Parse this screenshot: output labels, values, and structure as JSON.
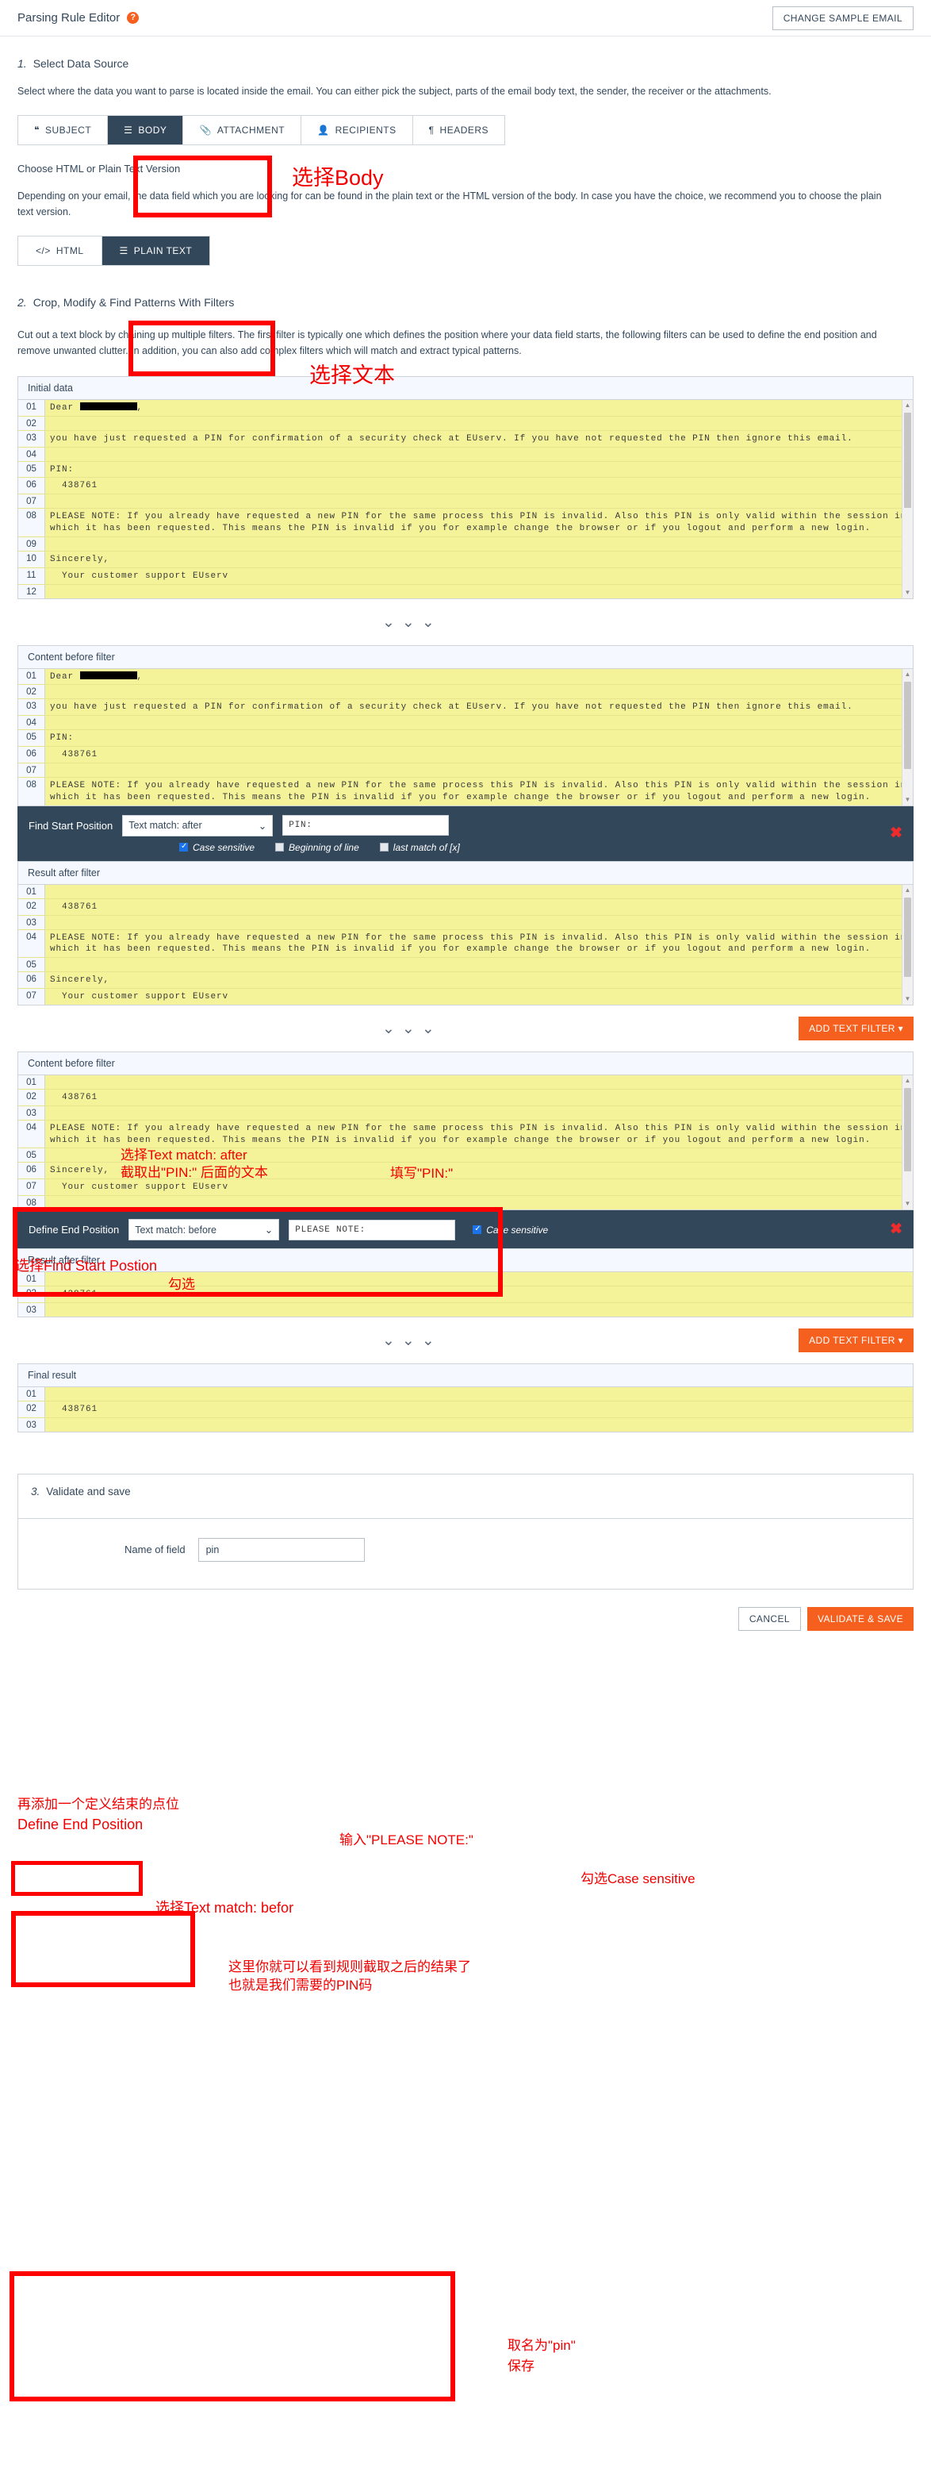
{
  "header": {
    "title": "Parsing Rule Editor",
    "help_icon": "question-mark-circle-icon",
    "change_sample_button": "CHANGE SAMPLE EMAIL"
  },
  "step1": {
    "number": "1.",
    "title": "Select Data Source",
    "description": "Select where the data you want to parse is located inside the email. You can either pick the subject, parts of the email body text, the sender, the receiver or the attachments.",
    "source_tabs": [
      {
        "label": "SUBJECT",
        "icon": "quote-icon",
        "active": false
      },
      {
        "label": "BODY",
        "icon": "lines-icon",
        "active": true
      },
      {
        "label": "ATTACHMENT",
        "icon": "paperclip-icon",
        "active": false
      },
      {
        "label": "RECIPIENTS",
        "icon": "user-icon",
        "active": false
      },
      {
        "label": "HEADERS",
        "icon": "pilcrow-icon",
        "active": false
      }
    ],
    "version_label": "Choose HTML or Plain Text Version",
    "version_description": "Depending on your email, the data field which you are looking for can be found in the plain text or the HTML version of the body. In case you have the choice, we recommend you to choose the plain text version.",
    "version_tabs": [
      {
        "label": "HTML",
        "icon": "code-icon",
        "active": false
      },
      {
        "label": "PLAIN TEXT",
        "icon": "lines-icon",
        "active": true
      }
    ]
  },
  "step2": {
    "number": "2.",
    "title": "Crop, Modify & Find Patterns With Filters",
    "description": "Cut out a text block by chaining up multiple filters. The first filter is typically one which defines the position where your data field starts, the following filters can be used to define the end position and remove unwanted clutter. In addition, you can also add complex filters which will match and extract typical patterns."
  },
  "panels": {
    "initial_data": {
      "title": "Initial data",
      "rows": [
        {
          "n": "01",
          "text": "Dear ████████,",
          "redacted": true
        },
        {
          "n": "02",
          "text": ""
        },
        {
          "n": "03",
          "text": "you have just requested a PIN for confirmation of a security check at EUserv. If you have not requested the PIN then ignore this email."
        },
        {
          "n": "04",
          "text": ""
        },
        {
          "n": "05",
          "text": "PIN:"
        },
        {
          "n": "06",
          "text": "  438761"
        },
        {
          "n": "07",
          "text": ""
        },
        {
          "n": "08",
          "text": "PLEASE NOTE: If you already have requested a new PIN for the same process this PIN is invalid. Also this PIN is only valid within the session in which it has been requested. This means the PIN is invalid if you for example change the browser or if you logout and perform a new login."
        },
        {
          "n": "09",
          "text": ""
        },
        {
          "n": "10",
          "text": "Sincerely,"
        },
        {
          "n": "11",
          "text": "  Your customer support EUserv"
        },
        {
          "n": "12",
          "text": ""
        }
      ]
    },
    "content_before_filter_1": {
      "title": "Content before filter",
      "rows": [
        {
          "n": "01",
          "text": "Dear ████████,",
          "redacted": true
        },
        {
          "n": "02",
          "text": ""
        },
        {
          "n": "03",
          "text": "you have just requested a PIN for confirmation of a security check at EUserv. If you have not requested the PIN then ignore this email."
        },
        {
          "n": "04",
          "text": ""
        },
        {
          "n": "05",
          "text": "PIN:"
        },
        {
          "n": "06",
          "text": "  438761"
        },
        {
          "n": "07",
          "text": ""
        },
        {
          "n": "08",
          "text": "PLEASE NOTE: If you already have requested a new PIN for the same process this PIN is invalid. Also this PIN is only valid within the session in which it has been requested. This means the PIN is invalid if you for example change the browser or if you logout and perform a new login."
        }
      ]
    },
    "result_after_filter_1": {
      "title": "Result after filter",
      "rows": [
        {
          "n": "01",
          "text": ""
        },
        {
          "n": "02",
          "text": "  438761"
        },
        {
          "n": "03",
          "text": ""
        },
        {
          "n": "04",
          "text": "PLEASE NOTE: If you already have requested a new PIN for the same process this PIN is invalid. Also this PIN is only valid within the session in which it has been requested. This means the PIN is invalid if you for example change the browser or if you logout and perform a new login."
        },
        {
          "n": "05",
          "text": ""
        },
        {
          "n": "06",
          "text": "Sincerely,"
        },
        {
          "n": "07",
          "text": "  Your customer support EUserv"
        }
      ]
    },
    "content_before_filter_2": {
      "title": "Content before filter",
      "rows": [
        {
          "n": "01",
          "text": ""
        },
        {
          "n": "02",
          "text": "  438761"
        },
        {
          "n": "03",
          "text": ""
        },
        {
          "n": "04",
          "text": "PLEASE NOTE: If you already have requested a new PIN for the same process this PIN is invalid. Also this PIN is only valid within the session in which it has been requested. This means the PIN is invalid if you for example change the browser or if you logout and perform a new login."
        },
        {
          "n": "05",
          "text": ""
        },
        {
          "n": "06",
          "text": "Sincerely,"
        },
        {
          "n": "07",
          "text": "  Your customer support EUserv"
        },
        {
          "n": "08",
          "text": ""
        }
      ]
    },
    "result_after_filter_2": {
      "title": "Result after filter",
      "rows": [
        {
          "n": "01",
          "text": ""
        },
        {
          "n": "02",
          "text": "  438761"
        },
        {
          "n": "03",
          "text": ""
        }
      ]
    },
    "final_result": {
      "title": "Final result",
      "rows": [
        {
          "n": "01",
          "text": ""
        },
        {
          "n": "02",
          "text": "  438761"
        },
        {
          "n": "03",
          "text": ""
        }
      ]
    }
  },
  "filters": [
    {
      "label": "Find Start Position",
      "select_value": "Text match: after",
      "input_value": "PIN:",
      "options": [
        {
          "label": "Case sensitive",
          "checked": true
        },
        {
          "label": "Beginning of line",
          "checked": false
        },
        {
          "label": "last match of [x]",
          "checked": false
        }
      ],
      "remove_icon": "close-x-icon"
    },
    {
      "label": "Define End Position",
      "select_value": "Text match: before",
      "input_value": "PLEASE NOTE:",
      "options": [
        {
          "label": "Case sensitive",
          "checked": true
        }
      ],
      "remove_icon": "close-x-icon"
    }
  ],
  "add_text_filter_button": "ADD TEXT FILTER",
  "chevron_icon": "chevron-down-icon",
  "step3": {
    "number": "3.",
    "title": "Validate and save",
    "field_label": "Name of field",
    "field_value": "pin"
  },
  "footer": {
    "cancel_button": "CANCEL",
    "save_button": "VALIDATE & SAVE"
  },
  "annotations": {
    "select_body": "选择Body",
    "select_plaintext": "选择文本",
    "choose_text_match_after": "选择Text match: after",
    "extract_after_pin": "截取出\"PIN:\" 后面的文本",
    "fill_pin": "填写\"PIN:\"",
    "choose_find_start_position": "选择Find Start Postion",
    "check_it": "勾选",
    "add_end_position_1": "再添加一个定义结束的点位",
    "add_end_position_2": "Define End Position",
    "input_please_note": "输入\"PLEASE NOTE:\"",
    "choose_text_match_before": "选择Text match: befor",
    "check_case_sensitive": "勾选Case sensitive",
    "result_note_1": "这里你就可以看到规则截取之后的结果了",
    "result_note_2": "也就是我们需要的PIN码",
    "name_it_pin": "取名为\"pin\"",
    "save": "保存"
  },
  "colors": {
    "accent_orange": "#f5601f",
    "dark_navy": "#33475b",
    "code_yellow": "#f4f39a",
    "annotation_red": "#f20000"
  }
}
